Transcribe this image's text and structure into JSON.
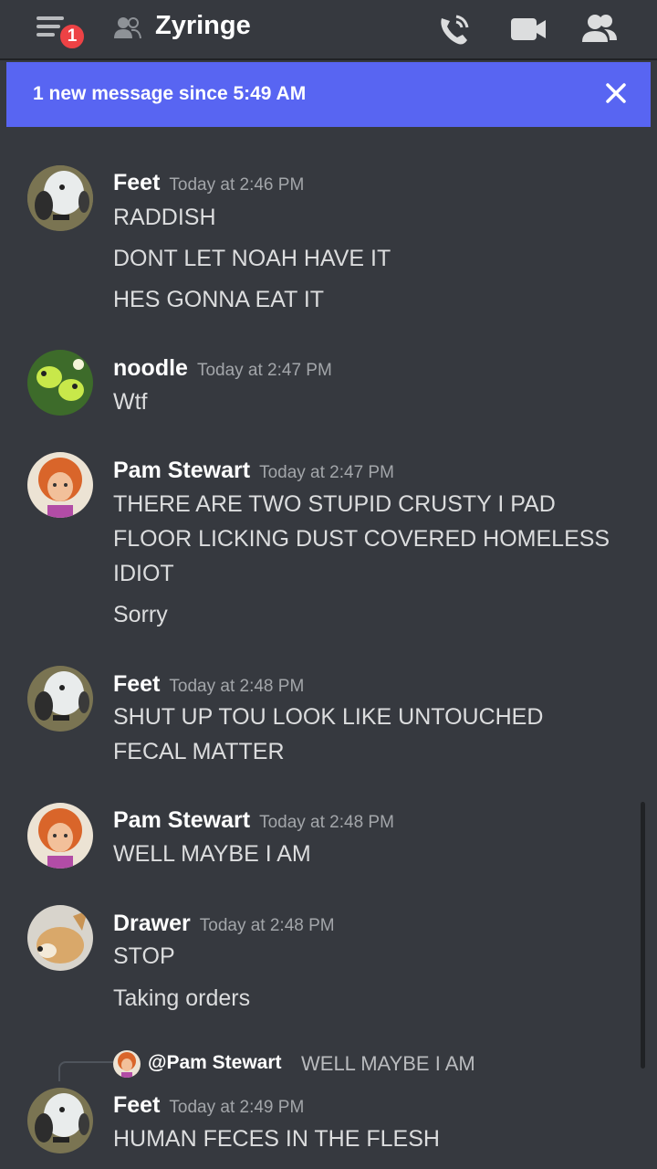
{
  "header": {
    "badge_count": "1",
    "channel_name": "Zyringe",
    "icons": [
      "menu-icon",
      "friends-icon",
      "call-icon",
      "video-icon",
      "members-icon"
    ]
  },
  "banner": {
    "text": "1 new message since 5:49 AM",
    "close_icon": "close-icon",
    "color": "#5865f2"
  },
  "messages": [
    {
      "author": "Feet",
      "time": "Today at 2:46 PM",
      "lines": [
        "RADDISH",
        "DONT LET NOAH HAVE IT",
        "HES GONNA EAT IT"
      ]
    },
    {
      "author": "noodle",
      "time": "Today at 2:47 PM",
      "lines": [
        "Wtf"
      ]
    },
    {
      "author": "Pam Stewart",
      "time": "Today at 2:47 PM",
      "lines": [
        "THERE ARE TWO STUPID CRUSTY I PAD",
        "FLOOR LICKING DUST COVERED HOMELESS",
        "IDIOT",
        "Sorry"
      ]
    },
    {
      "author": "Feet",
      "time": "Today at 2:48 PM",
      "lines": [
        "SHUT UP TOU LOOK LIKE  UNTOUCHED",
        "FECAL MATTER"
      ]
    },
    {
      "author": "Pam Stewart",
      "time": "Today at 2:48 PM",
      "lines": [
        "WELL MAYBE I AM"
      ]
    },
    {
      "author": "Drawer",
      "time": "Today at 2:48 PM",
      "lines": [
        "STOP",
        "Taking orders"
      ]
    },
    {
      "author": "Feet",
      "time": "Today at 2:49 PM",
      "lines": [
        "HUMAN  FECES IN THE FLESH"
      ],
      "reply": {
        "name": "@Pam Stewart",
        "text": "WELL MAYBE I AM"
      }
    }
  ]
}
